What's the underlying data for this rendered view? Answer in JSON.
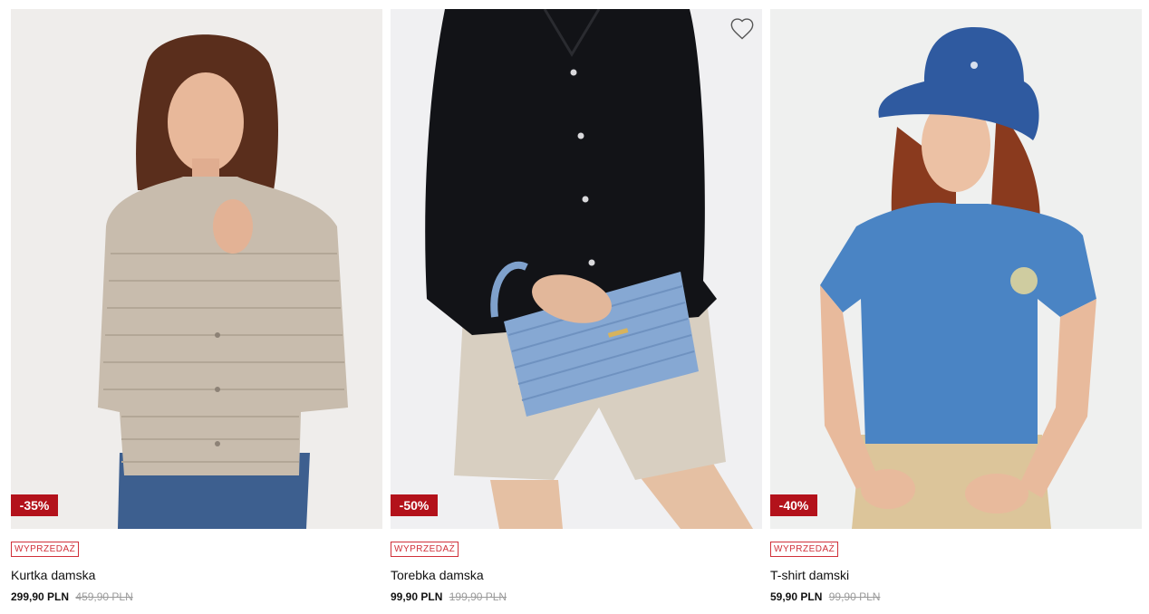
{
  "products": [
    {
      "name": "Kurtka damska",
      "tag": "WYPRZEDAŻ",
      "discount": "-35%",
      "price": "299,90 PLN",
      "old_price": "459,90 PLN",
      "image": "woman-beige-quilted-jacket-photo"
    },
    {
      "name": "Torebka damska",
      "tag": "WYPRZEDAŻ",
      "discount": "-50%",
      "price": "99,90 PLN",
      "old_price": "199,90 PLN",
      "image": "woman-black-shirt-blue-clutch-photo"
    },
    {
      "name": "T-shirt damski",
      "tag": "WYPRZEDAŻ",
      "discount": "-40%",
      "price": "59,90 PLN",
      "old_price": "99,90 PLN",
      "image": "woman-blue-tshirt-bucket-hat-photo"
    }
  ],
  "icons": {
    "favorite": "heart-outline-icon"
  },
  "colors": {
    "discount_badge": "#b3121b",
    "sale_tag": "#d0313a",
    "old_price": "#9b9b9b"
  }
}
